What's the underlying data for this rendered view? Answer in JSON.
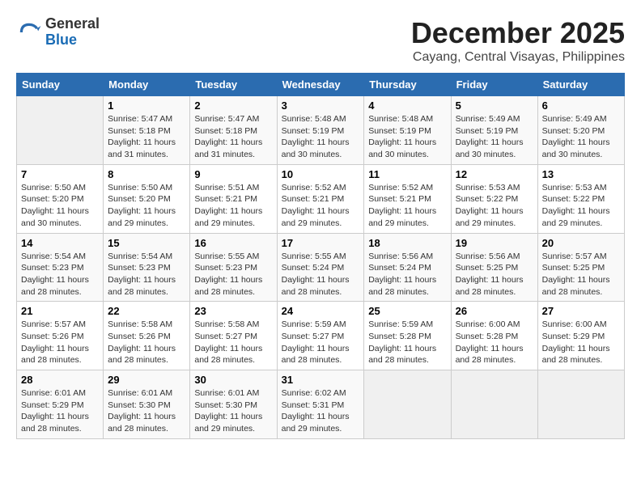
{
  "header": {
    "logo_general": "General",
    "logo_blue": "Blue",
    "month_year": "December 2025",
    "location": "Cayang, Central Visayas, Philippines"
  },
  "calendar": {
    "days_of_week": [
      "Sunday",
      "Monday",
      "Tuesday",
      "Wednesday",
      "Thursday",
      "Friday",
      "Saturday"
    ],
    "weeks": [
      [
        {
          "day": "",
          "sunrise": "",
          "sunset": "",
          "daylight": ""
        },
        {
          "day": "1",
          "sunrise": "Sunrise: 5:47 AM",
          "sunset": "Sunset: 5:18 PM",
          "daylight": "Daylight: 11 hours and 31 minutes."
        },
        {
          "day": "2",
          "sunrise": "Sunrise: 5:47 AM",
          "sunset": "Sunset: 5:18 PM",
          "daylight": "Daylight: 11 hours and 31 minutes."
        },
        {
          "day": "3",
          "sunrise": "Sunrise: 5:48 AM",
          "sunset": "Sunset: 5:19 PM",
          "daylight": "Daylight: 11 hours and 30 minutes."
        },
        {
          "day": "4",
          "sunrise": "Sunrise: 5:48 AM",
          "sunset": "Sunset: 5:19 PM",
          "daylight": "Daylight: 11 hours and 30 minutes."
        },
        {
          "day": "5",
          "sunrise": "Sunrise: 5:49 AM",
          "sunset": "Sunset: 5:19 PM",
          "daylight": "Daylight: 11 hours and 30 minutes."
        },
        {
          "day": "6",
          "sunrise": "Sunrise: 5:49 AM",
          "sunset": "Sunset: 5:20 PM",
          "daylight": "Daylight: 11 hours and 30 minutes."
        }
      ],
      [
        {
          "day": "7",
          "sunrise": "Sunrise: 5:50 AM",
          "sunset": "Sunset: 5:20 PM",
          "daylight": "Daylight: 11 hours and 30 minutes."
        },
        {
          "day": "8",
          "sunrise": "Sunrise: 5:50 AM",
          "sunset": "Sunset: 5:20 PM",
          "daylight": "Daylight: 11 hours and 29 minutes."
        },
        {
          "day": "9",
          "sunrise": "Sunrise: 5:51 AM",
          "sunset": "Sunset: 5:21 PM",
          "daylight": "Daylight: 11 hours and 29 minutes."
        },
        {
          "day": "10",
          "sunrise": "Sunrise: 5:52 AM",
          "sunset": "Sunset: 5:21 PM",
          "daylight": "Daylight: 11 hours and 29 minutes."
        },
        {
          "day": "11",
          "sunrise": "Sunrise: 5:52 AM",
          "sunset": "Sunset: 5:21 PM",
          "daylight": "Daylight: 11 hours and 29 minutes."
        },
        {
          "day": "12",
          "sunrise": "Sunrise: 5:53 AM",
          "sunset": "Sunset: 5:22 PM",
          "daylight": "Daylight: 11 hours and 29 minutes."
        },
        {
          "day": "13",
          "sunrise": "Sunrise: 5:53 AM",
          "sunset": "Sunset: 5:22 PM",
          "daylight": "Daylight: 11 hours and 29 minutes."
        }
      ],
      [
        {
          "day": "14",
          "sunrise": "Sunrise: 5:54 AM",
          "sunset": "Sunset: 5:23 PM",
          "daylight": "Daylight: 11 hours and 28 minutes."
        },
        {
          "day": "15",
          "sunrise": "Sunrise: 5:54 AM",
          "sunset": "Sunset: 5:23 PM",
          "daylight": "Daylight: 11 hours and 28 minutes."
        },
        {
          "day": "16",
          "sunrise": "Sunrise: 5:55 AM",
          "sunset": "Sunset: 5:23 PM",
          "daylight": "Daylight: 11 hours and 28 minutes."
        },
        {
          "day": "17",
          "sunrise": "Sunrise: 5:55 AM",
          "sunset": "Sunset: 5:24 PM",
          "daylight": "Daylight: 11 hours and 28 minutes."
        },
        {
          "day": "18",
          "sunrise": "Sunrise: 5:56 AM",
          "sunset": "Sunset: 5:24 PM",
          "daylight": "Daylight: 11 hours and 28 minutes."
        },
        {
          "day": "19",
          "sunrise": "Sunrise: 5:56 AM",
          "sunset": "Sunset: 5:25 PM",
          "daylight": "Daylight: 11 hours and 28 minutes."
        },
        {
          "day": "20",
          "sunrise": "Sunrise: 5:57 AM",
          "sunset": "Sunset: 5:25 PM",
          "daylight": "Daylight: 11 hours and 28 minutes."
        }
      ],
      [
        {
          "day": "21",
          "sunrise": "Sunrise: 5:57 AM",
          "sunset": "Sunset: 5:26 PM",
          "daylight": "Daylight: 11 hours and 28 minutes."
        },
        {
          "day": "22",
          "sunrise": "Sunrise: 5:58 AM",
          "sunset": "Sunset: 5:26 PM",
          "daylight": "Daylight: 11 hours and 28 minutes."
        },
        {
          "day": "23",
          "sunrise": "Sunrise: 5:58 AM",
          "sunset": "Sunset: 5:27 PM",
          "daylight": "Daylight: 11 hours and 28 minutes."
        },
        {
          "day": "24",
          "sunrise": "Sunrise: 5:59 AM",
          "sunset": "Sunset: 5:27 PM",
          "daylight": "Daylight: 11 hours and 28 minutes."
        },
        {
          "day": "25",
          "sunrise": "Sunrise: 5:59 AM",
          "sunset": "Sunset: 5:28 PM",
          "daylight": "Daylight: 11 hours and 28 minutes."
        },
        {
          "day": "26",
          "sunrise": "Sunrise: 6:00 AM",
          "sunset": "Sunset: 5:28 PM",
          "daylight": "Daylight: 11 hours and 28 minutes."
        },
        {
          "day": "27",
          "sunrise": "Sunrise: 6:00 AM",
          "sunset": "Sunset: 5:29 PM",
          "daylight": "Daylight: 11 hours and 28 minutes."
        }
      ],
      [
        {
          "day": "28",
          "sunrise": "Sunrise: 6:01 AM",
          "sunset": "Sunset: 5:29 PM",
          "daylight": "Daylight: 11 hours and 28 minutes."
        },
        {
          "day": "29",
          "sunrise": "Sunrise: 6:01 AM",
          "sunset": "Sunset: 5:30 PM",
          "daylight": "Daylight: 11 hours and 28 minutes."
        },
        {
          "day": "30",
          "sunrise": "Sunrise: 6:01 AM",
          "sunset": "Sunset: 5:30 PM",
          "daylight": "Daylight: 11 hours and 29 minutes."
        },
        {
          "day": "31",
          "sunrise": "Sunrise: 6:02 AM",
          "sunset": "Sunset: 5:31 PM",
          "daylight": "Daylight: 11 hours and 29 minutes."
        },
        {
          "day": "",
          "sunrise": "",
          "sunset": "",
          "daylight": ""
        },
        {
          "day": "",
          "sunrise": "",
          "sunset": "",
          "daylight": ""
        },
        {
          "day": "",
          "sunrise": "",
          "sunset": "",
          "daylight": ""
        }
      ]
    ]
  }
}
